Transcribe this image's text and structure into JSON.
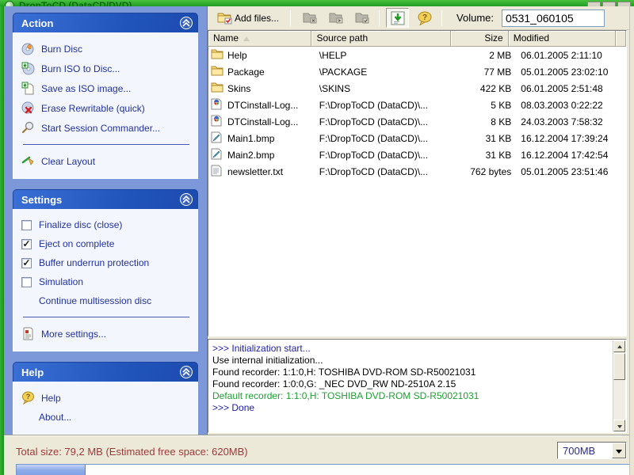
{
  "colors": {
    "titlebar_green": "#1f9c22",
    "sidebar_blue": "#7d98d9",
    "panel_header_blue": "#2155bc",
    "task_text_blue": "#21319e",
    "status_text_red": "#9c3a3a",
    "log_navy": "#1b1bb0",
    "log_green": "#1f9e33",
    "progress_fill_blue": "#8fadea"
  },
  "window": {
    "title": "DropToCD (DataCD/DVD)"
  },
  "sidebar": {
    "action": {
      "title": "Action",
      "items": [
        {
          "label": "Burn Disc"
        },
        {
          "label": "Burn ISO to Disc..."
        },
        {
          "label": "Save as ISO image..."
        },
        {
          "label": "Erase Rewritable (quick)"
        },
        {
          "label": "Start Session Commander..."
        }
      ],
      "footer": {
        "label": "Clear Layout"
      }
    },
    "settings": {
      "title": "Settings",
      "options": [
        {
          "label": "Finalize disc (close)",
          "checked": false,
          "mark": ""
        },
        {
          "label": "Eject on complete",
          "checked": true,
          "mark": "✓"
        },
        {
          "label": "Buffer underrun protection",
          "checked": true,
          "mark": "✓"
        },
        {
          "label": "Simulation",
          "checked": false,
          "mark": ""
        }
      ],
      "link": "Continue multisession disc",
      "footer": {
        "label": "More settings..."
      }
    },
    "help": {
      "title": "Help",
      "items": [
        {
          "label": "Help"
        },
        {
          "label": "About..."
        }
      ]
    }
  },
  "toolbar": {
    "add_files_label": "Add files...",
    "volume_label": "Volume:",
    "volume_value": "0531_060105",
    "icons": {
      "add_files": "folder-add-check",
      "disabled_1": "folder-remove",
      "disabled_2": "folder-run",
      "disabled_3": "folder-check",
      "pressed": "import-list-green-arrow",
      "help": "question-bubble"
    }
  },
  "filelist": {
    "columns": {
      "name": "Name",
      "source": "Source path",
      "size": "Size",
      "modified": "Modified"
    },
    "rows": [
      {
        "name": "Help",
        "source": "\\HELP",
        "size": "2 MB",
        "modified": "06.01.2005 2:11:10",
        "icon": "folder"
      },
      {
        "name": "Package",
        "source": "\\PACKAGE",
        "size": "77 MB",
        "modified": "05.01.2005 23:02:10",
        "icon": "folder"
      },
      {
        "name": "Skins",
        "source": "\\SKINS",
        "size": "422 KB",
        "modified": "06.01.2005 2:51:48",
        "icon": "folder"
      },
      {
        "name": "DTCinstall-Log...",
        "source": "F:\\DropToCD (DataCD)\\...",
        "size": "5 KB",
        "modified": "08.03.2003 0:22:22",
        "icon": "log-file"
      },
      {
        "name": "DTCinstall-Log...",
        "source": "F:\\DropToCD (DataCD)\\...",
        "size": "8 KB",
        "modified": "24.03.2003 7:58:32",
        "icon": "log-file"
      },
      {
        "name": "Main1.bmp",
        "source": "F:\\DropToCD (DataCD)\\...",
        "size": "31 KB",
        "modified": "16.12.2004 17:39:24",
        "icon": "bitmap-image"
      },
      {
        "name": "Main2.bmp",
        "source": "F:\\DropToCD (DataCD)\\...",
        "size": "31 KB",
        "modified": "16.12.2004 17:42:54",
        "icon": "bitmap-image"
      },
      {
        "name": "newsletter.txt",
        "source": "F:\\DropToCD (DataCD)\\...",
        "size": "762 bytes",
        "modified": "05.01.2005 23:51:46",
        "icon": "text-file"
      }
    ]
  },
  "log": {
    "lines": [
      {
        "text": ">>> Initialization start...",
        "color": "#1b1bb0"
      },
      {
        "text": "Use internal initialization...",
        "color": "#000000"
      },
      {
        "text": "Found recorder: 1:1:0,H: TOSHIBA DVD-ROM SD-R50021031",
        "color": "#000000"
      },
      {
        "text": "Found recorder: 1:0:0,G: _NEC   DVD_RW ND-2510A 2.15",
        "color": "#000000"
      },
      {
        "text": "Default recorder: 1:1:0,H: TOSHIBA DVD-ROM SD-R50021031",
        "color": "#1f9e33"
      },
      {
        "text": ">>> Done",
        "color": "#1b1bb0"
      }
    ]
  },
  "statusbar": {
    "total_text": "Total size: 79,2 MB (Estimated free space: 620MB)",
    "capacity_value": "700MB",
    "progress_percent": 11.3
  }
}
